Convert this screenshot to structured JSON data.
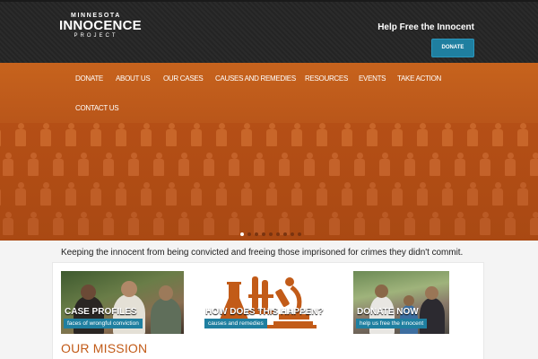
{
  "header": {
    "logo_line1": "MINNESOTA",
    "logo_line2": "INNOCENCE",
    "logo_line3": "PROJECT",
    "tagline": "Help Free the Innocent",
    "donate_label": "DONATE"
  },
  "nav": {
    "items": [
      {
        "label": "DONATE"
      },
      {
        "label": "ABOUT US"
      },
      {
        "label": "OUR CASES"
      },
      {
        "label": "CAUSES AND REMEDIES"
      },
      {
        "label": "RESOURCES"
      },
      {
        "label": "EVENTS"
      },
      {
        "label": "TAKE ACTION"
      },
      {
        "label": "CONTACT US"
      }
    ]
  },
  "hero": {
    "slide_count": 9,
    "active_slide": 1
  },
  "mission_strip": "Keeping the innocent from being convicted and freeing those imprisoned for crimes they didn't commit.",
  "cards": [
    {
      "title": "CASE PROFILES",
      "tag": "faces of wrongful conviction"
    },
    {
      "title": "HOW DOES THIS HAPPEN?",
      "tag": "causes and remedies"
    },
    {
      "title": "DONATE NOW",
      "tag": "help us free the innocent"
    }
  ],
  "mission_title": "OUR MISSION",
  "colors": {
    "accent_orange": "#c25b18",
    "button_blue": "#1f7fa0",
    "header_dark": "#262626"
  }
}
